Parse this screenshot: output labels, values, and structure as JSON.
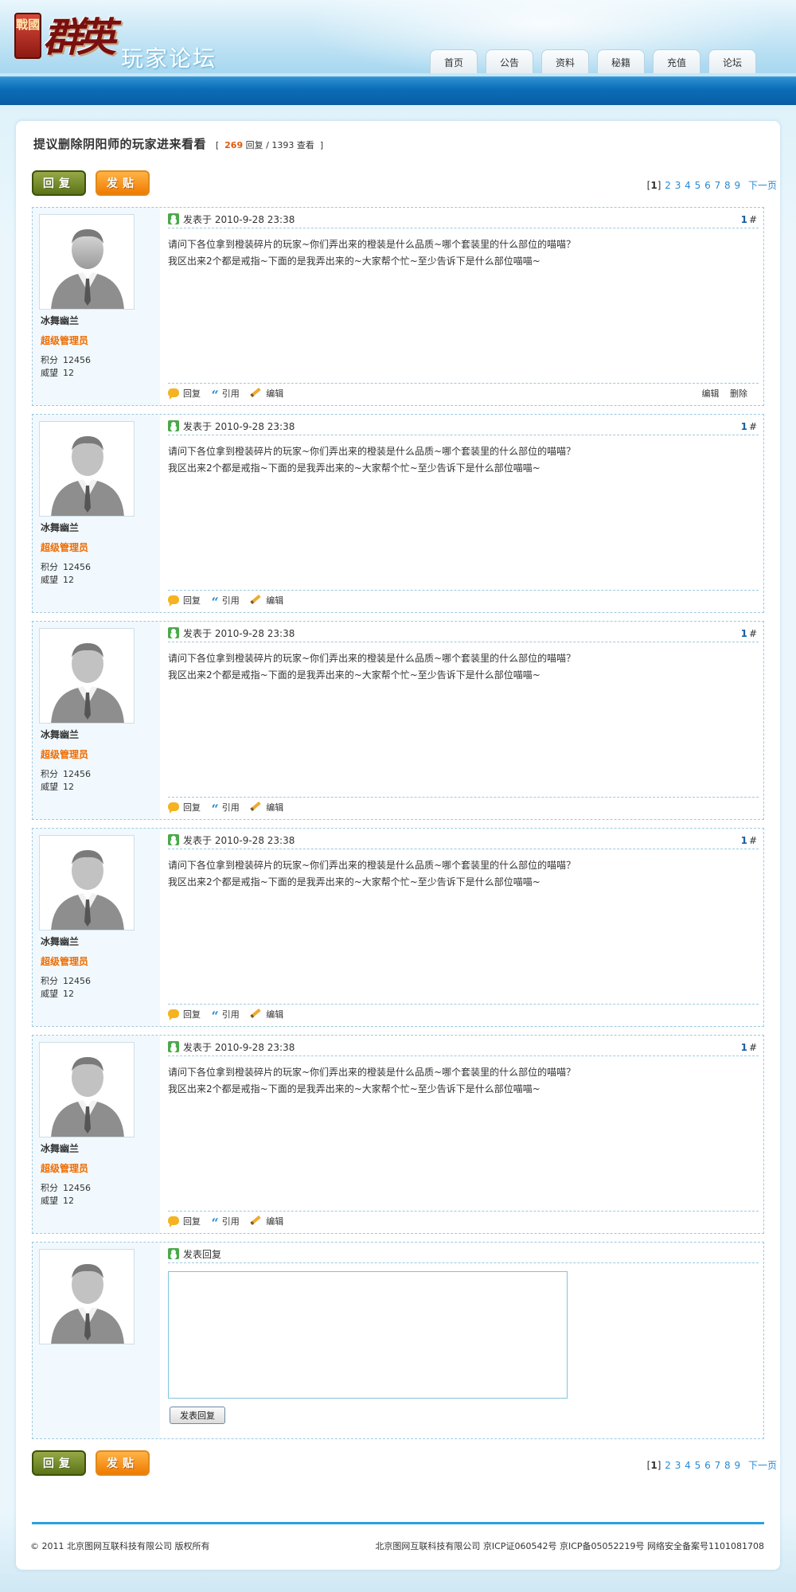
{
  "brand": {
    "seal": "戰國",
    "name": "群英",
    "subtitle": "玩家论坛"
  },
  "nav": [
    "首页",
    "公告",
    "资料",
    "秘籍",
    "充值",
    "论坛"
  ],
  "topic": {
    "title": "提议删除阴阳师的玩家进来看看",
    "replies": "269",
    "replies_label": "回复",
    "sep": "/",
    "views": "1393",
    "views_label": "查看",
    "bracket_open": "[",
    "bracket_close": "]"
  },
  "buttons": {
    "reply": "回复",
    "post": "发贴"
  },
  "pager": {
    "current": "1",
    "pages": [
      "2",
      "3",
      "4",
      "5",
      "6",
      "7",
      "8",
      "9"
    ],
    "next": "下一页",
    "open": "[",
    "close": "]"
  },
  "posts": [
    {
      "user": "冰舞幽兰",
      "role": "超级管理员",
      "points_label": "积分",
      "points": "12456",
      "prestige_label": "威望",
      "prestige": "12",
      "posted_label": "发表于",
      "time": "2010-9-28 23:38",
      "floor": "1",
      "lines": [
        "请问下各位拿到橙装碎片的玩家~你们弄出来的橙装是什么品质~哪个套装里的什么部位的喵喵？",
        "我区出来2个都是戒指~下面的是我弄出来的~大家帮个忙~至少告诉下是什么部位喵喵~"
      ],
      "actions": [
        "回复",
        "引用",
        "编辑"
      ],
      "admin": [
        "编辑",
        "删除"
      ]
    },
    {
      "user": "冰舞幽兰",
      "role": "超级管理员",
      "points_label": "积分",
      "points": "12456",
      "prestige_label": "威望",
      "prestige": "12",
      "posted_label": "发表于",
      "time": "2010-9-28 23:38",
      "floor": "1",
      "lines": [
        "请问下各位拿到橙装碎片的玩家~你们弄出来的橙装是什么品质~哪个套装里的什么部位的喵喵？",
        "我区出来2个都是戒指~下面的是我弄出来的~大家帮个忙~至少告诉下是什么部位喵喵~"
      ],
      "actions": [
        "回复",
        "引用",
        "编辑"
      ]
    },
    {
      "user": "冰舞幽兰",
      "role": "超级管理员",
      "points_label": "积分",
      "points": "12456",
      "prestige_label": "威望",
      "prestige": "12",
      "posted_label": "发表于",
      "time": "2010-9-28 23:38",
      "floor": "1",
      "lines": [
        "请问下各位拿到橙装碎片的玩家~你们弄出来的橙装是什么品质~哪个套装里的什么部位的喵喵？",
        "我区出来2个都是戒指~下面的是我弄出来的~大家帮个忙~至少告诉下是什么部位喵喵~"
      ],
      "actions": [
        "回复",
        "引用",
        "编辑"
      ]
    },
    {
      "user": "冰舞幽兰",
      "role": "超级管理员",
      "points_label": "积分",
      "points": "12456",
      "prestige_label": "威望",
      "prestige": "12",
      "posted_label": "发表于",
      "time": "2010-9-28 23:38",
      "floor": "1",
      "lines": [
        "请问下各位拿到橙装碎片的玩家~你们弄出来的橙装是什么品质~哪个套装里的什么部位的喵喵？",
        "我区出来2个都是戒指~下面的是我弄出来的~大家帮个忙~至少告诉下是什么部位喵喵~"
      ],
      "actions": [
        "回复",
        "引用",
        "编辑"
      ]
    },
    {
      "user": "冰舞幽兰",
      "role": "超级管理员",
      "points_label": "积分",
      "points": "12456",
      "prestige_label": "威望",
      "prestige": "12",
      "posted_label": "发表于",
      "time": "2010-9-28 23:38",
      "floor": "1",
      "lines": [
        "请问下各位拿到橙装碎片的玩家~你们弄出来的橙装是什么品质~哪个套装里的什么部位的喵喵？",
        "我区出来2个都是戒指~下面的是我弄出来的~大家帮个忙~至少告诉下是什么部位喵喵~"
      ],
      "actions": [
        "回复",
        "引用",
        "编辑"
      ]
    }
  ],
  "reply_form": {
    "label": "发表回复",
    "submit": "发表回复",
    "textarea_value": ""
  },
  "footer": {
    "left": "© 2011 北京图网互联科技有限公司 版权所有",
    "right": "北京图网互联科技有限公司 京ICP证060542号 京ICP备05052219号 网络安全备案号1101081708"
  },
  "colors": {
    "accent": "#2a8ad2",
    "role": "#ef6c00",
    "hot": "#e35a0b",
    "nav_bar": "#0b6db8",
    "reply_btn": "#5b7317",
    "post_btn": "#f07a00"
  }
}
